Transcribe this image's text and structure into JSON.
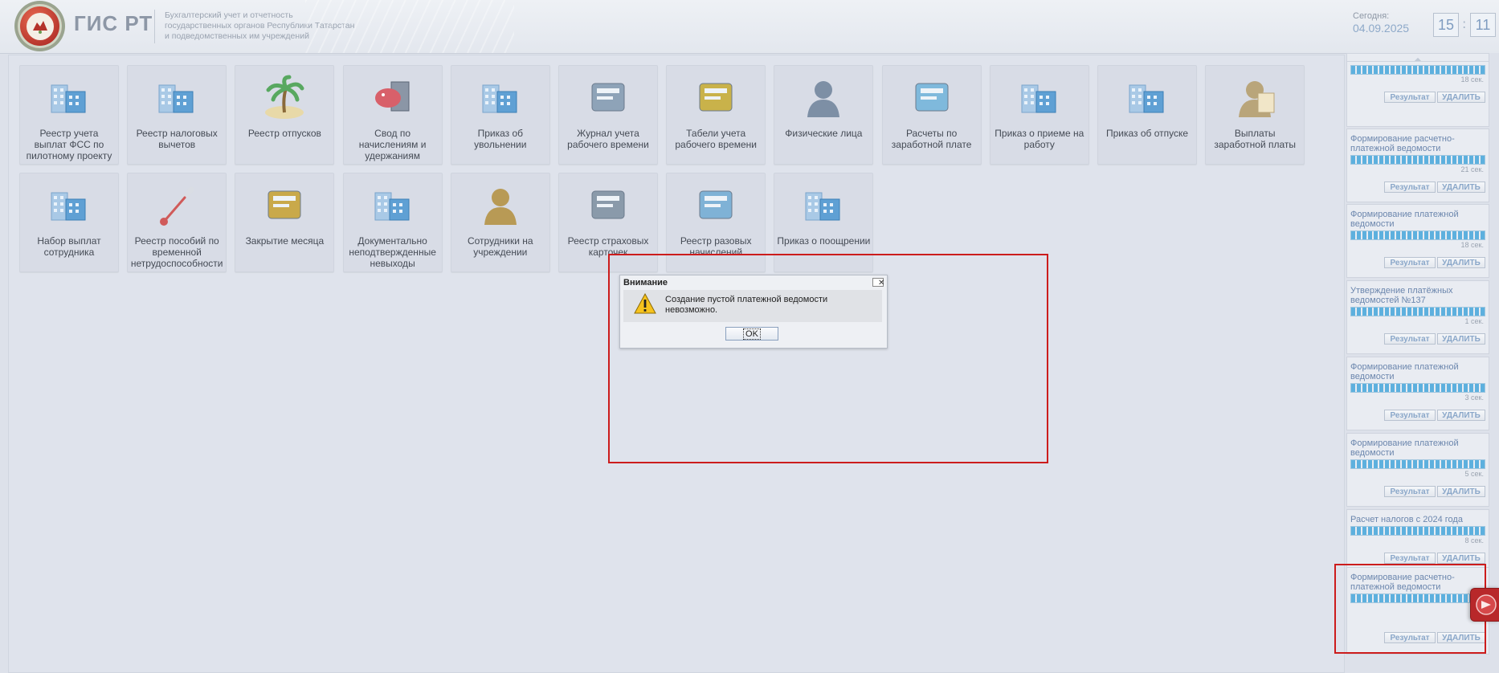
{
  "header": {
    "logo_title": "ГИС РТ",
    "logo_subtitle": [
      "Бухгалтерский учет и отчетность",
      "государственных органов Республики Татарстан",
      "и подведомственных им учреждений"
    ],
    "today_label": "Сегодня:",
    "today_date": "04.09.2025",
    "clock_hours": "15",
    "clock_minutes": "11"
  },
  "tiles": [
    {
      "label": "Реестр учета выплат ФСС по пилотному проекту",
      "icon": "buildings-icon"
    },
    {
      "label": "Реестр налоговых вычетов",
      "icon": "buildings-icon"
    },
    {
      "label": "Реестр отпусков",
      "icon": "palm-beach-icon"
    },
    {
      "label": "Свод по начислениям и удержаниям",
      "icon": "piggy-bank-icon"
    },
    {
      "label": "Приказ об увольнении",
      "icon": "buildings-icon"
    },
    {
      "label": "Журнал учета рабочего времени",
      "icon": "calendar-clock-icon"
    },
    {
      "label": "Табели учета рабочего времени",
      "icon": "hourglass-book-icon"
    },
    {
      "label": "Физические лица",
      "icon": "person-icon"
    },
    {
      "label": "Расчеты по заработной плате",
      "icon": "card-icon"
    },
    {
      "label": "Приказ о приеме на работу",
      "icon": "buildings-icon"
    },
    {
      "label": "Приказ об отпуске",
      "icon": "buildings-icon"
    },
    {
      "label": "Выплаты заработной платы",
      "icon": "person-document-icon"
    },
    {
      "label": "Набор выплат сотрудника",
      "icon": "buildings-icon"
    },
    {
      "label": "Реестр пособий по временной нетрудоспособности",
      "icon": "thermometer-icon"
    },
    {
      "label": "Закрытие месяца",
      "icon": "lock-calendar-icon"
    },
    {
      "label": "Документально неподтвержденные невыходы",
      "icon": "buildings-icon"
    },
    {
      "label": "Сотрудники на учреждении",
      "icon": "employee-icon"
    },
    {
      "label": "Реестр страховых карточек",
      "icon": "book-disc-icon"
    },
    {
      "label": "Реестр разовых начислений",
      "icon": "money-gift-icon"
    },
    {
      "label": "Приказ о поощрении",
      "icon": "buildings-icon"
    }
  ],
  "dialog": {
    "title": "Внимание",
    "message": "Создание пустой платежной ведомости невозможно.",
    "ok_label": "OK",
    "close_glyph": "✕"
  },
  "tasks": [
    {
      "name": "",
      "time": "18 сек.",
      "result_label": "Результат",
      "delete_label": "УДАЛИТЬ"
    },
    {
      "name": "Формирование расчетно-платежной ведомости",
      "time": "21 сек.",
      "result_label": "Результат",
      "delete_label": "УДАЛИТЬ"
    },
    {
      "name": "Формирование платежной ведомости",
      "time": "18 сек.",
      "result_label": "Результат",
      "delete_label": "УДАЛИТЬ"
    },
    {
      "name": "Утверждение платёжных ведомостей №137",
      "time": "1 сек.",
      "result_label": "Результат",
      "delete_label": "УДАЛИТЬ"
    },
    {
      "name": "Формирование платежной ведомости",
      "time": "3 сек.",
      "result_label": "Результат",
      "delete_label": "УДАЛИТЬ"
    },
    {
      "name": "Формирование платежной ведомости",
      "time": "5 сек.",
      "result_label": "Результат",
      "delete_label": "УДАЛИТЬ"
    },
    {
      "name": "Расчет налогов с 2024 года",
      "time": "8 сек.",
      "result_label": "Результат",
      "delete_label": "УДАЛИТЬ"
    },
    {
      "name": "Формирование расчетно-платежной ведомости",
      "time": "",
      "result_label": "Результат",
      "delete_label": "УДАЛИТЬ"
    }
  ],
  "colors": {
    "accent_blue": "#5db0de",
    "highlight_red": "#cc1c1c",
    "background": "#dde1ea"
  }
}
